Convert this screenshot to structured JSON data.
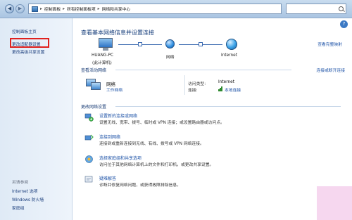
{
  "address_bar": {
    "crumbs": [
      "控制面板",
      "所有控制面板项",
      "网络和共享中心"
    ],
    "separator": "▸"
  },
  "left_pane": {
    "home": "控制面板主页",
    "change_adapter": "更改适配器设置",
    "advanced_sharing": "更改高级共享设置",
    "see_also_title": "另请参阅",
    "see_also": [
      "Internet 选项",
      "Windows 防火墙",
      "家庭组"
    ]
  },
  "main": {
    "title": "查看基本网络信息并设置连接",
    "full_map": "查看完整映射",
    "map": {
      "computer_name": "HUANG-PC",
      "computer_sub": "(此计算机)",
      "network": "网络",
      "internet": "Internet"
    },
    "active_networks_title": "查看活动网络",
    "connect_disconnect": "连接或断开连接",
    "network_name": "网络",
    "network_type": "工作网络",
    "access_type_label": "访问类型:",
    "access_type_value": "Internet",
    "connections_label": "连接:",
    "connections_value": "本地连接",
    "change_settings_title": "更改网络设置",
    "tasks": [
      {
        "link": "设置新的连接或网络",
        "desc": "设置无线、宽带、拨号、临时或 VPN 连接；或设置路由器或访问点。"
      },
      {
        "link": "连接到网络",
        "desc": "连接到或重新连接到无线、有线、拨号或 VPN 网络连接。"
      },
      {
        "link": "选择家庭组和共享选项",
        "desc": "访问位于其他网络计算机上的文件和打印机，或更改共享设置。"
      },
      {
        "link": "疑难解答",
        "desc": "诊断并修复网络问题，或获得故障排除信息。"
      }
    ]
  }
}
